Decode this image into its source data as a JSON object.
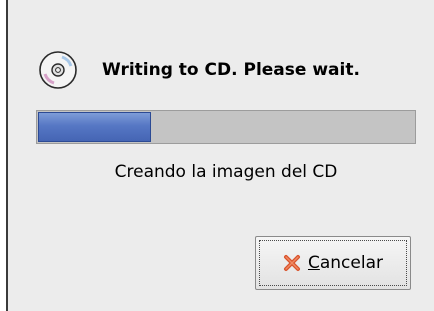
{
  "dialog": {
    "title": "Writing to CD. Please wait.",
    "icon": "cd-icon",
    "progress": 0.3,
    "status_text": "Creando la imagen del CD",
    "cancel_button": {
      "icon": "x-icon",
      "mnemonic": "C",
      "label_rest": "ancelar"
    }
  },
  "colors": {
    "dialog_bg": "#ececec",
    "progress_track": "#c4c4c4",
    "progress_fill": "#5677c4",
    "cancel_icon": "#d9532c"
  }
}
